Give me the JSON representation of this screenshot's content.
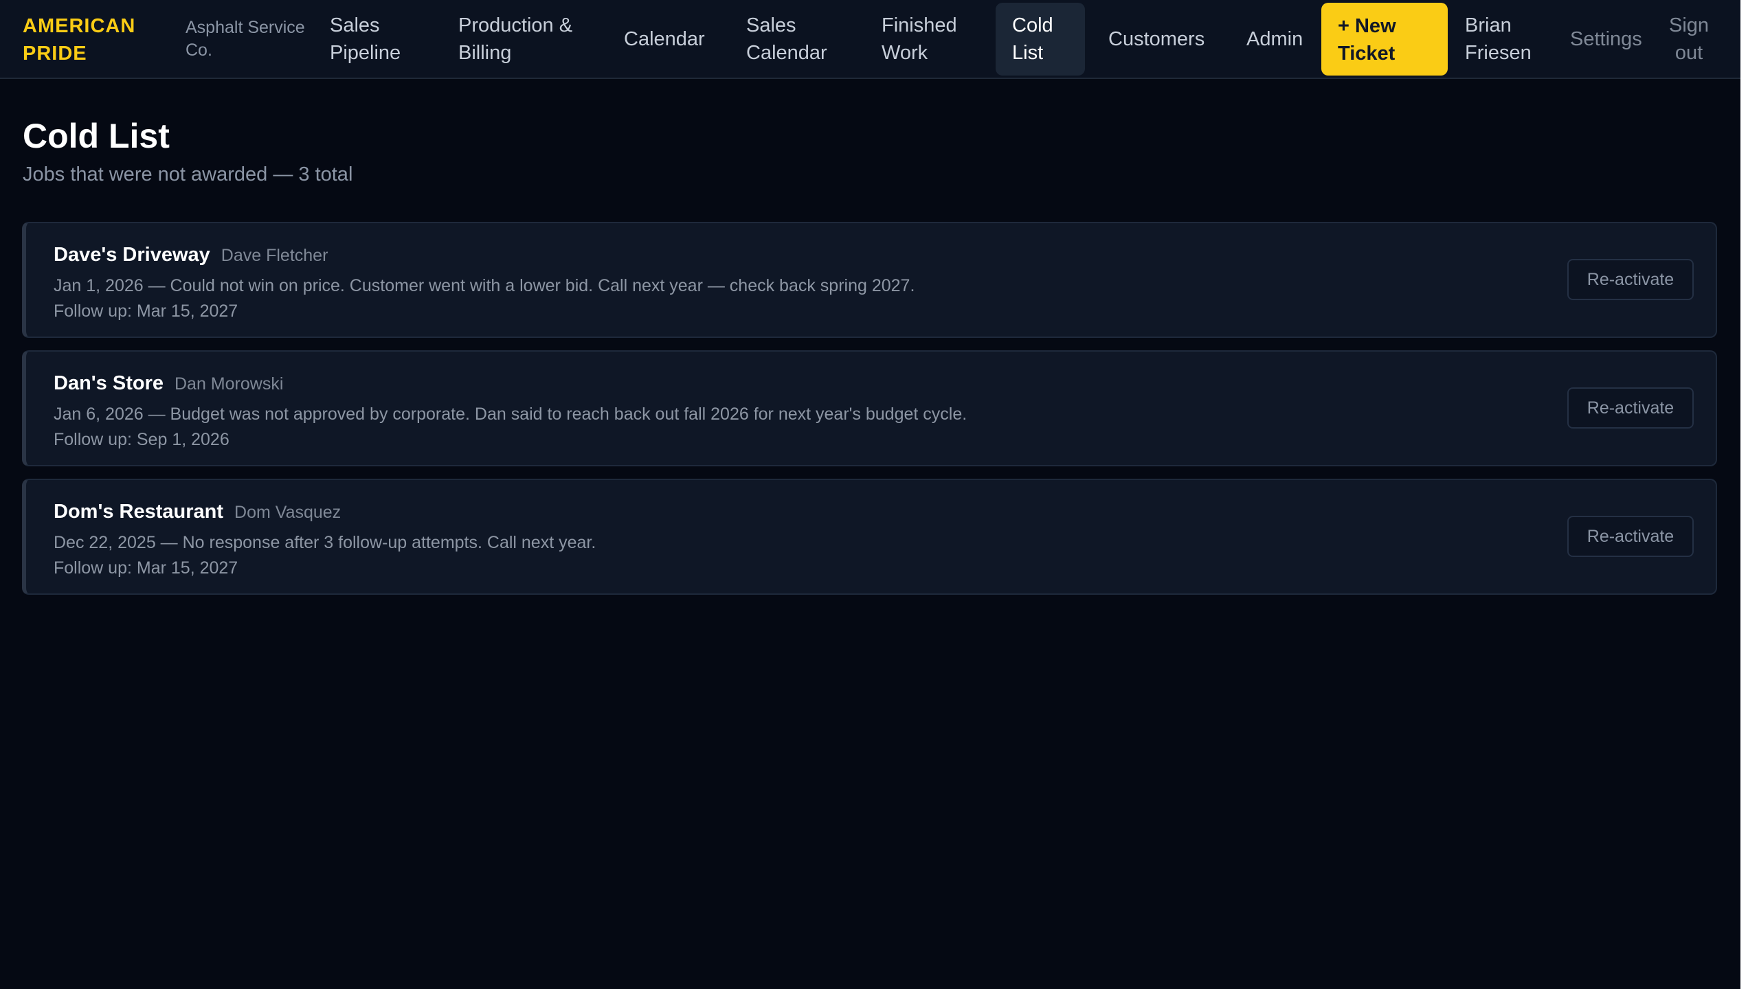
{
  "nav": {
    "brand_line1": "AMERICAN",
    "brand_line2": "PRIDE",
    "company_line1": "Asphalt Service",
    "company_line2": "Co.",
    "links": [
      {
        "line1": "Sales",
        "line2": "Pipeline"
      },
      {
        "line1": "Production &",
        "line2": "Billing"
      },
      {
        "line1": "Calendar",
        "line2": ""
      },
      {
        "line1": "Sales",
        "line2": "Calendar"
      },
      {
        "line1": "Finished",
        "line2": "Work"
      },
      {
        "line1": "Cold",
        "line2": "List"
      },
      {
        "line1": "Customers",
        "line2": ""
      },
      {
        "line1": "Admin",
        "line2": ""
      }
    ],
    "new_ticket_line1": "+ New",
    "new_ticket_line2": "Ticket",
    "user_line1": "Brian",
    "user_line2": "Friesen",
    "settings": "Settings",
    "signout_line1": "Sign",
    "signout_line2": "out"
  },
  "page": {
    "title": "Cold List",
    "subtitle": "Jobs that were not awarded — 3 total"
  },
  "jobs": [
    {
      "name": "Dave's Driveway",
      "contact": "Dave Fletcher",
      "note": "Jan 1, 2026 — Could not win on price. Customer went with a lower bid. Call next year — check back spring 2027.",
      "follow_up": "Follow up: Mar 15, 2027",
      "action": "Re-activate"
    },
    {
      "name": "Dan's Store",
      "contact": "Dan Morowski",
      "note": "Jan 6, 2026 — Budget was not approved by corporate. Dan said to reach back out fall 2026 for next year's budget cycle.",
      "follow_up": "Follow up: Sep 1, 2026",
      "action": "Re-activate"
    },
    {
      "name": "Dom's Restaurant",
      "contact": "Dom Vasquez",
      "note": "Dec 22, 2025 — No response after 3 follow-up attempts. Call next year.",
      "follow_up": "Follow up: Mar 15, 2027",
      "action": "Re-activate"
    }
  ],
  "colors": {
    "accent": "#facc15",
    "background": "#050913",
    "card": "#0f1726",
    "nav_active": "#1b2636"
  }
}
